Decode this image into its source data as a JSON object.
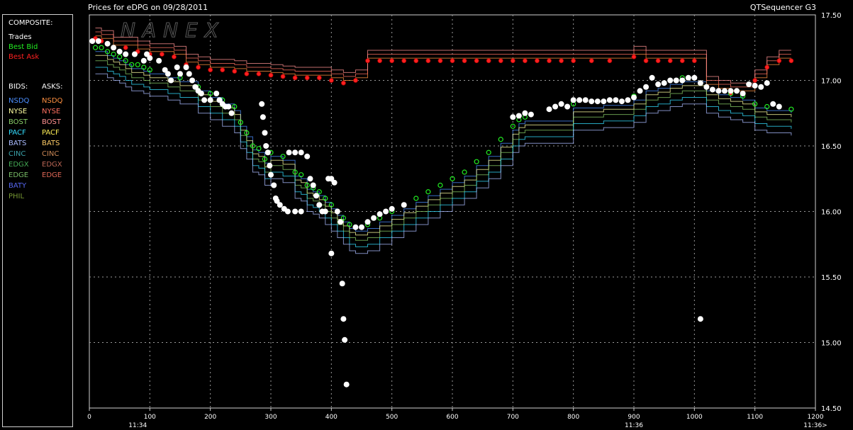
{
  "header": {
    "title": "Prices for  eDPG  on  09/28/2011",
    "app_name": "QTSequencer G3"
  },
  "watermark": "NANEX",
  "legend": {
    "composite_title": "COMPOSITE:",
    "composite": [
      {
        "label": "Trades",
        "color": "#ffffff"
      },
      {
        "label": "Best Bid",
        "color": "#22ee22"
      },
      {
        "label": "Best Ask",
        "color": "#ff2020"
      }
    ],
    "bids_title": "BIDS:",
    "asks_title": "ASKS:",
    "bids": [
      {
        "label": "NSDQ",
        "color": "#4c8fff"
      },
      {
        "label": "NYSE",
        "color": "#ffffa0"
      },
      {
        "label": "BOST",
        "color": "#88cc66"
      },
      {
        "label": "PACF",
        "color": "#33ddff"
      },
      {
        "label": "BATS",
        "color": "#aabbff"
      },
      {
        "label": "CINC",
        "color": "#3aa0a8"
      },
      {
        "label": "EDGX",
        "color": "#44aa55"
      },
      {
        "label": "EDGE",
        "color": "#77bb66"
      },
      {
        "label": "BATY",
        "color": "#5566ee"
      },
      {
        "label": "PHIL",
        "color": "#779933"
      }
    ],
    "asks": [
      {
        "label": "NSDQ",
        "color": "#ff9040"
      },
      {
        "label": "NYSE",
        "color": "#ff7060"
      },
      {
        "label": "BOST",
        "color": "#ff9090"
      },
      {
        "label": "PACF",
        "color": "#ffee55"
      },
      {
        "label": "BATS",
        "color": "#ffcc66"
      },
      {
        "label": "CINC",
        "color": "#cc8855"
      },
      {
        "label": "EDGX",
        "color": "#bb6655"
      },
      {
        "label": "EDGE",
        "color": "#dd6655"
      }
    ]
  },
  "chart_data": {
    "type": "scatter",
    "title": "Prices for  eDPG  on  09/28/2011",
    "xlim": [
      0,
      1200
    ],
    "ylim": [
      14.5,
      17.5
    ],
    "x_ticks": [
      0,
      100,
      200,
      300,
      400,
      500,
      600,
      700,
      800,
      900,
      1000,
      1100,
      1200
    ],
    "y_ticks": [
      14.5,
      15.0,
      15.5,
      16.0,
      16.5,
      17.0,
      17.5
    ],
    "y_tick_labels": [
      "14.50",
      "15.00",
      "15.50",
      "16.00",
      "16.50",
      "17.00",
      "17.50"
    ],
    "time_labels": [
      {
        "x": 80,
        "label": "11:34"
      },
      {
        "x": 900,
        "label": "11:36"
      },
      {
        "x": 1200,
        "label": "11:36>"
      }
    ],
    "grid": true,
    "legend_position": "left",
    "series": [
      {
        "name": "Trades",
        "color": "#ffffff",
        "points": [
          [
            5,
            17.3
          ],
          [
            15,
            17.3
          ],
          [
            30,
            17.28
          ],
          [
            40,
            17.25
          ],
          [
            50,
            17.22
          ],
          [
            60,
            17.2
          ],
          [
            75,
            17.2
          ],
          [
            90,
            17.15
          ],
          [
            95,
            17.2
          ],
          [
            100,
            17.17
          ],
          [
            115,
            17.15
          ],
          [
            125,
            17.08
          ],
          [
            130,
            17.05
          ],
          [
            135,
            17.0
          ],
          [
            145,
            17.1
          ],
          [
            150,
            17.05
          ],
          [
            160,
            17.1
          ],
          [
            165,
            17.05
          ],
          [
            170,
            17.0
          ],
          [
            175,
            16.95
          ],
          [
            180,
            16.92
          ],
          [
            185,
            16.9
          ],
          [
            190,
            16.85
          ],
          [
            200,
            16.85
          ],
          [
            210,
            16.9
          ],
          [
            215,
            16.85
          ],
          [
            220,
            16.82
          ],
          [
            225,
            16.8
          ],
          [
            230,
            16.8
          ],
          [
            235,
            16.75
          ],
          [
            285,
            16.82
          ],
          [
            287,
            16.72
          ],
          [
            290,
            16.6
          ],
          [
            292,
            16.5
          ],
          [
            295,
            16.45
          ],
          [
            298,
            16.35
          ],
          [
            300,
            16.28
          ],
          [
            305,
            16.2
          ],
          [
            308,
            16.1
          ],
          [
            310,
            16.08
          ],
          [
            315,
            16.05
          ],
          [
            322,
            16.02
          ],
          [
            328,
            16.0
          ],
          [
            340,
            16.0
          ],
          [
            350,
            16.0
          ],
          [
            330,
            16.45
          ],
          [
            340,
            16.45
          ],
          [
            350,
            16.45
          ],
          [
            360,
            16.42
          ],
          [
            365,
            16.25
          ],
          [
            370,
            16.2
          ],
          [
            375,
            16.12
          ],
          [
            380,
            16.05
          ],
          [
            385,
            16.0
          ],
          [
            390,
            16.0
          ],
          [
            395,
            16.25
          ],
          [
            400,
            16.25
          ],
          [
            405,
            16.22
          ],
          [
            410,
            16.0
          ],
          [
            415,
            15.92
          ],
          [
            400,
            15.68
          ],
          [
            418,
            15.45
          ],
          [
            420,
            15.18
          ],
          [
            422,
            15.02
          ],
          [
            425,
            14.68
          ],
          [
            440,
            15.88
          ],
          [
            450,
            15.88
          ],
          [
            460,
            15.92
          ],
          [
            470,
            15.95
          ],
          [
            480,
            15.98
          ],
          [
            490,
            16.0
          ],
          [
            500,
            16.02
          ],
          [
            520,
            16.05
          ],
          [
            700,
            16.72
          ],
          [
            710,
            16.73
          ],
          [
            720,
            16.75
          ],
          [
            730,
            16.74
          ],
          [
            760,
            16.78
          ],
          [
            770,
            16.8
          ],
          [
            780,
            16.82
          ],
          [
            790,
            16.8
          ],
          [
            800,
            16.85
          ],
          [
            810,
            16.85
          ],
          [
            820,
            16.85
          ],
          [
            830,
            16.84
          ],
          [
            840,
            16.84
          ],
          [
            850,
            16.84
          ],
          [
            860,
            16.85
          ],
          [
            870,
            16.85
          ],
          [
            880,
            16.84
          ],
          [
            890,
            16.85
          ],
          [
            900,
            16.87
          ],
          [
            910,
            16.92
          ],
          [
            920,
            16.95
          ],
          [
            930,
            17.02
          ],
          [
            940,
            16.97
          ],
          [
            950,
            16.98
          ],
          [
            960,
            17.0
          ],
          [
            970,
            17.0
          ],
          [
            980,
            17.0
          ],
          [
            990,
            17.02
          ],
          [
            1000,
            17.02
          ],
          [
            1010,
            16.98
          ],
          [
            1020,
            16.95
          ],
          [
            1030,
            16.93
          ],
          [
            1040,
            16.92
          ],
          [
            1050,
            16.92
          ],
          [
            1060,
            16.92
          ],
          [
            1070,
            16.92
          ],
          [
            1080,
            16.9
          ],
          [
            1090,
            16.97
          ],
          [
            1100,
            16.96
          ],
          [
            1110,
            16.95
          ],
          [
            1120,
            16.98
          ],
          [
            1130,
            16.82
          ],
          [
            1140,
            16.8
          ],
          [
            1010,
            15.18
          ]
        ]
      },
      {
        "name": "Best Bid",
        "color": "#22ee22",
        "points": [
          [
            10,
            17.25
          ],
          [
            20,
            17.25
          ],
          [
            30,
            17.22
          ],
          [
            40,
            17.2
          ],
          [
            50,
            17.18
          ],
          [
            60,
            17.15
          ],
          [
            70,
            17.12
          ],
          [
            80,
            17.12
          ],
          [
            90,
            17.1
          ],
          [
            100,
            17.08
          ],
          [
            130,
            17.05
          ],
          [
            150,
            17.02
          ],
          [
            180,
            16.95
          ],
          [
            200,
            16.9
          ],
          [
            220,
            16.85
          ],
          [
            240,
            16.8
          ],
          [
            250,
            16.68
          ],
          [
            260,
            16.6
          ],
          [
            270,
            16.5
          ],
          [
            280,
            16.48
          ],
          [
            290,
            16.4
          ],
          [
            300,
            16.45
          ],
          [
            320,
            16.42
          ],
          [
            340,
            16.3
          ],
          [
            350,
            16.28
          ],
          [
            360,
            16.2
          ],
          [
            370,
            16.18
          ],
          [
            380,
            16.15
          ],
          [
            390,
            16.1
          ],
          [
            400,
            16.05
          ],
          [
            410,
            16.0
          ],
          [
            420,
            15.95
          ],
          [
            430,
            15.9
          ],
          [
            440,
            15.88
          ],
          [
            460,
            15.9
          ],
          [
            480,
            15.95
          ],
          [
            500,
            16.0
          ],
          [
            520,
            16.05
          ],
          [
            540,
            16.1
          ],
          [
            560,
            16.15
          ],
          [
            580,
            16.2
          ],
          [
            600,
            16.25
          ],
          [
            620,
            16.3
          ],
          [
            640,
            16.38
          ],
          [
            660,
            16.45
          ],
          [
            680,
            16.55
          ],
          [
            700,
            16.65
          ],
          [
            710,
            16.7
          ],
          [
            720,
            16.72
          ],
          [
            800,
            16.82
          ],
          [
            850,
            16.84
          ],
          [
            900,
            16.88
          ],
          [
            920,
            16.95
          ],
          [
            940,
            16.97
          ],
          [
            960,
            17.0
          ],
          [
            980,
            17.02
          ],
          [
            1000,
            17.02
          ],
          [
            1020,
            16.95
          ],
          [
            1040,
            16.92
          ],
          [
            1060,
            16.9
          ],
          [
            1080,
            16.88
          ],
          [
            1100,
            16.82
          ],
          [
            1120,
            16.8
          ],
          [
            1140,
            16.8
          ],
          [
            1160,
            16.78
          ]
        ]
      },
      {
        "name": "Best Ask",
        "color": "#ff2020",
        "points": [
          [
            10,
            17.32
          ],
          [
            20,
            17.3
          ],
          [
            40,
            17.25
          ],
          [
            60,
            17.25
          ],
          [
            80,
            17.22
          ],
          [
            100,
            17.2
          ],
          [
            120,
            17.2
          ],
          [
            140,
            17.18
          ],
          [
            160,
            17.12
          ],
          [
            180,
            17.1
          ],
          [
            200,
            17.08
          ],
          [
            220,
            17.08
          ],
          [
            240,
            17.07
          ],
          [
            260,
            17.05
          ],
          [
            280,
            17.05
          ],
          [
            300,
            17.04
          ],
          [
            320,
            17.03
          ],
          [
            340,
            17.02
          ],
          [
            360,
            17.02
          ],
          [
            380,
            17.02
          ],
          [
            400,
            17.0
          ],
          [
            420,
            16.98
          ],
          [
            440,
            17.0
          ],
          [
            460,
            17.15
          ],
          [
            480,
            17.15
          ],
          [
            500,
            17.15
          ],
          [
            520,
            17.15
          ],
          [
            540,
            17.15
          ],
          [
            560,
            17.15
          ],
          [
            580,
            17.15
          ],
          [
            600,
            17.15
          ],
          [
            620,
            17.15
          ],
          [
            640,
            17.15
          ],
          [
            660,
            17.15
          ],
          [
            680,
            17.15
          ],
          [
            700,
            17.15
          ],
          [
            720,
            17.15
          ],
          [
            740,
            17.15
          ],
          [
            760,
            17.15
          ],
          [
            780,
            17.15
          ],
          [
            800,
            17.15
          ],
          [
            830,
            17.15
          ],
          [
            860,
            17.15
          ],
          [
            900,
            17.18
          ],
          [
            920,
            17.15
          ],
          [
            940,
            17.15
          ],
          [
            960,
            17.15
          ],
          [
            980,
            17.15
          ],
          [
            1000,
            17.15
          ],
          [
            1020,
            16.95
          ],
          [
            1040,
            16.92
          ],
          [
            1060,
            16.9
          ],
          [
            1080,
            16.9
          ],
          [
            1100,
            17.0
          ],
          [
            1120,
            17.1
          ],
          [
            1140,
            17.15
          ],
          [
            1160,
            17.15
          ]
        ]
      }
    ]
  }
}
